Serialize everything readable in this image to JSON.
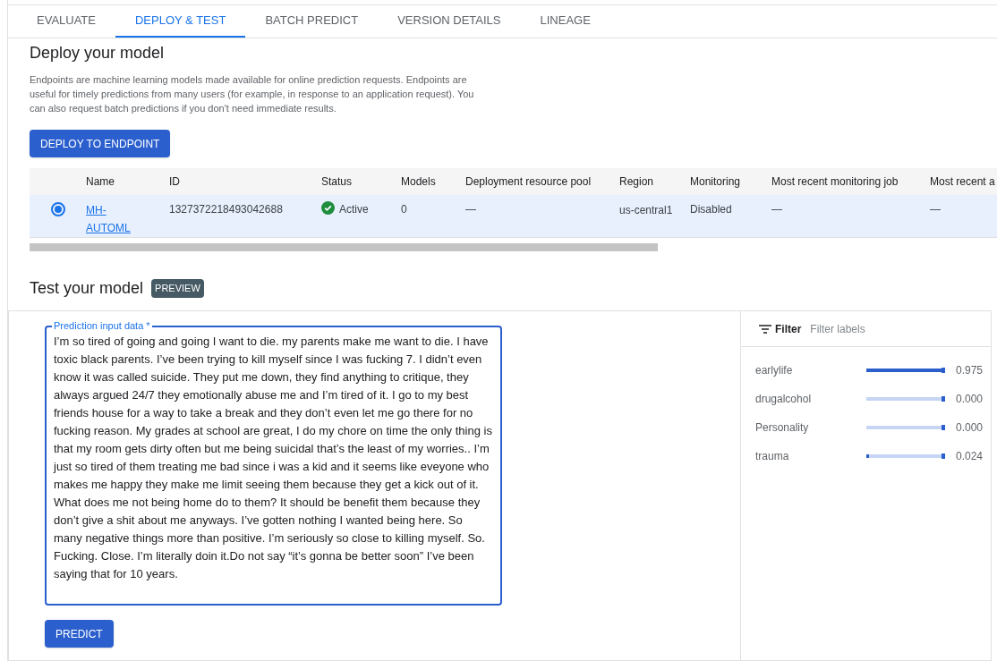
{
  "tabs": [
    {
      "label": "EVALUATE",
      "selected": false
    },
    {
      "label": "DEPLOY & TEST",
      "selected": true
    },
    {
      "label": "BATCH PREDICT",
      "selected": false
    },
    {
      "label": "VERSION DETAILS",
      "selected": false
    },
    {
      "label": "LINEAGE",
      "selected": false
    }
  ],
  "deploy": {
    "title": "Deploy your model",
    "description": "Endpoints are machine learning models made available for online prediction requests. Endpoints are useful for timely predictions from many users (for example, in response to an application request). You can also request batch predictions if you don't need immediate results.",
    "button": "DEPLOY TO ENDPOINT"
  },
  "table": {
    "columns": [
      "Name",
      "ID",
      "Status",
      "Models",
      "Deployment resource pool",
      "Region",
      "Monitoring",
      "Most recent monitoring job",
      "Most recent a"
    ],
    "rows": [
      {
        "selected": true,
        "name": "MH-AUTOML",
        "id": "1327372218493042688",
        "status": "Active",
        "models": "0",
        "pool": "—",
        "region": "us-central1",
        "monitoring": "Disabled",
        "job": "—",
        "recent": "—"
      }
    ]
  },
  "test": {
    "title": "Test your model",
    "badge": "PREVIEW",
    "field_label": "Prediction input data *",
    "value": "I’m so tired of going and going I want to die. my parents make me want to die. I have toxic black parents. I’ve been trying to kill myself since I was fucking 7. I didn’t even know it was called suicide. They put me down, they find anything to critique, they always argued 24/7 they emotionally abuse me and I’m tired of it. I go to my best friends house for a way to take a break and they don’t even let me go there for no fucking reason. My grades at school are great, I do my chore on time the only thing is that my room gets dirty often but me being suicidal that’s the least of my worries.. I’m just so tired of them treating me bad since i was a kid and it seems like eveyone who makes me happy they make me limit seeing them because they get a kick out of it. What does me not being home do to them? It should be benefit them because they don’t give a shit about me anyways. I’ve gotten nothing I wanted being here. So many negative things more than positive. I’m seriously so close to killing myself. So. Fucking. Close. I’m literally doin it.Do not say “it’s gonna be better soon” I’ve been saying that for 10 years.",
    "button": "PREDICT"
  },
  "results": {
    "filter_label": "Filter",
    "filter_placeholder": "Filter labels",
    "labels": [
      {
        "name": "earlylife",
        "level": 0.975,
        "score": "0.975"
      },
      {
        "name": "drugalcohol",
        "level": 0,
        "score": "0.000"
      },
      {
        "name": "Personality",
        "level": 0,
        "score": "0.000"
      },
      {
        "name": "trauma",
        "level": 0.024,
        "score": "0.024"
      }
    ]
  }
}
